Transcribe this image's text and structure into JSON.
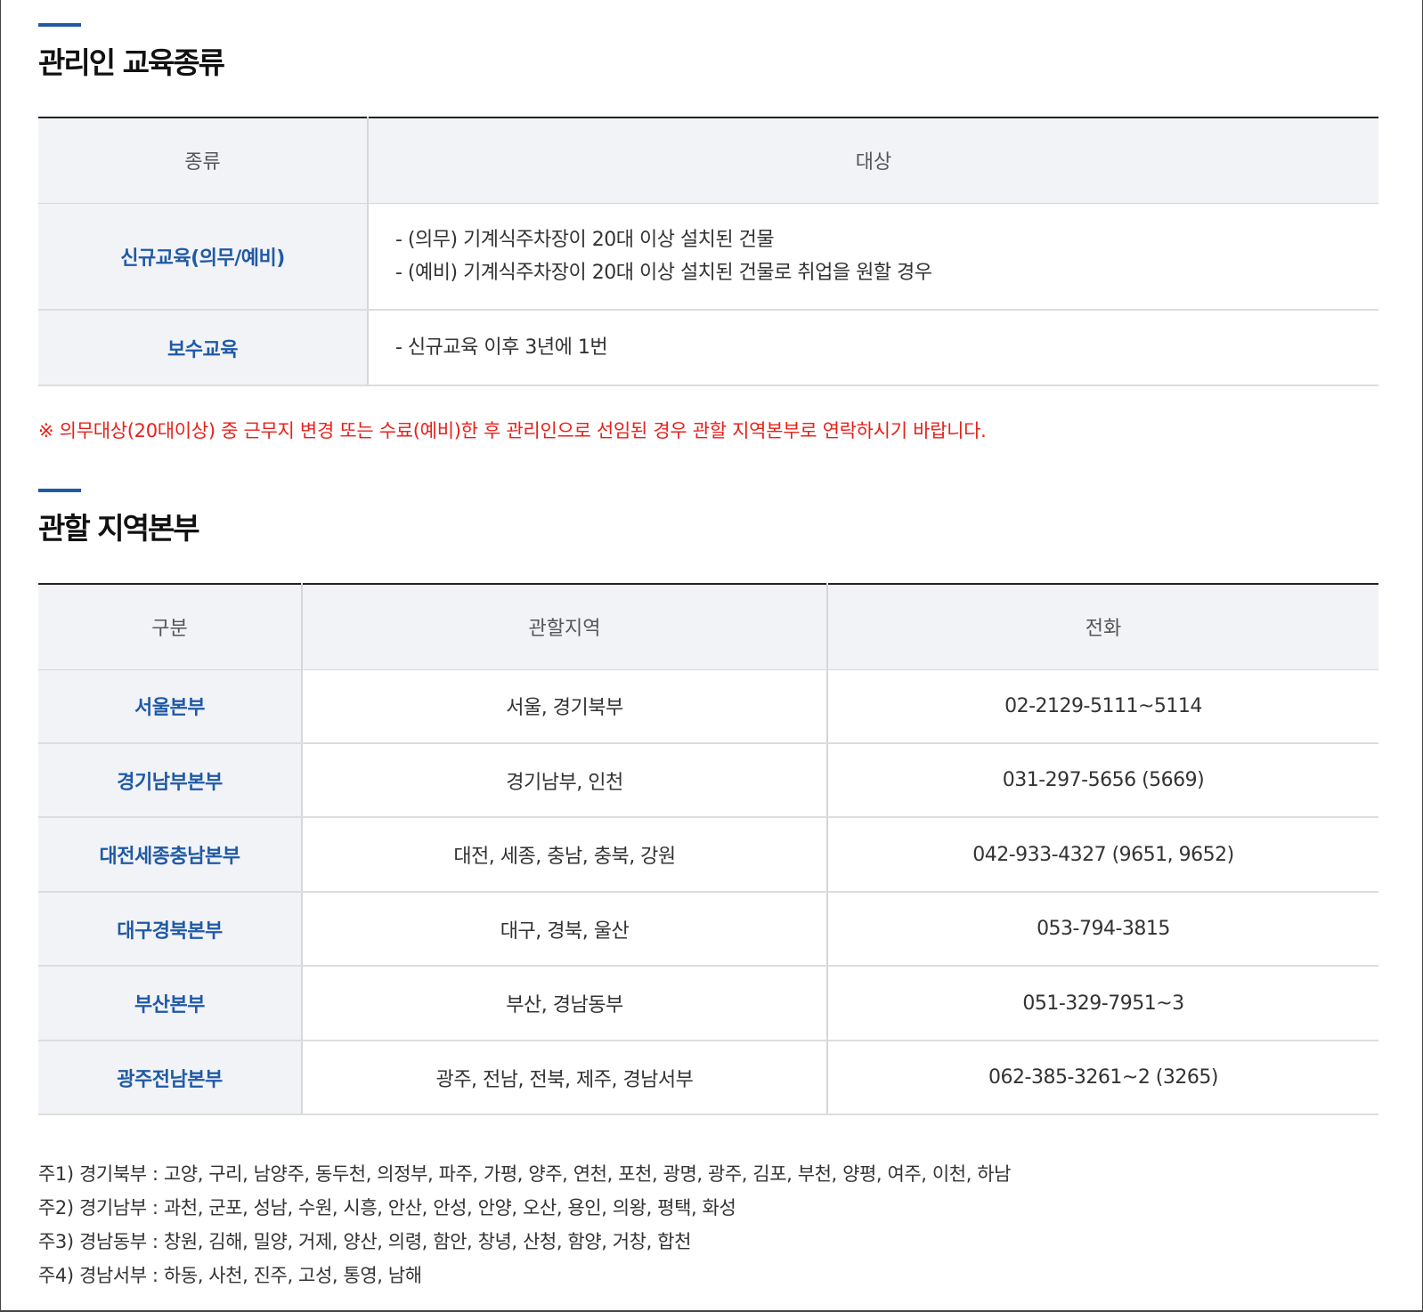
{
  "section1": {
    "title": "관리인 교육종류",
    "headers": [
      "종류",
      "대상"
    ],
    "rows": [
      {
        "type": "신규교육(의무/예비)",
        "lines": [
          "- (의무) 기계식주차장이 20대 이상 설치된 건물",
          "- (예비) 기계식주차장이 20대 이상 설치된 건물로 취업을 원할 경우"
        ]
      },
      {
        "type": "보수교육",
        "lines": [
          "- 신규교육 이후 3년에 1번"
        ]
      }
    ],
    "notice": "※ 의무대상(20대이상) 중 근무지 변경 또는 수료(예비)한 후 관리인으로 선임된 경우 관할 지역본부로 연락하시기 바랍니다."
  },
  "section2": {
    "title": "관할 지역본부",
    "headers": [
      "구분",
      "관할지역",
      "전화"
    ],
    "rows": [
      {
        "name": "서울본부",
        "region": "서울, 경기북부",
        "phone": "02-2129-5111~5114"
      },
      {
        "name": "경기남부본부",
        "region": "경기남부, 인천",
        "phone": "031-297-5656 (5669)"
      },
      {
        "name": "대전세종충남본부",
        "region": "대전, 세종, 충남, 충북, 강원",
        "phone": "042-933-4327 (9651, 9652)"
      },
      {
        "name": "대구경북본부",
        "region": "대구, 경북, 울산",
        "phone": "053-794-3815"
      },
      {
        "name": "부산본부",
        "region": "부산, 경남동부",
        "phone": "051-329-7951~3"
      },
      {
        "name": "광주전남본부",
        "region": "광주, 전남, 전북, 제주, 경남서부",
        "phone": "062-385-3261~2 (3265)"
      }
    ],
    "footnotes": [
      "주1) 경기북부 : 고양, 구리, 남양주, 동두천, 의정부, 파주, 가평, 양주, 연천, 포천, 광명, 광주, 김포, 부천, 양평, 여주, 이천, 하남",
      "주2) 경기남부 : 과천, 군포, 성남, 수원, 시흥, 안산, 안성, 안양, 오산, 용인, 의왕, 평택, 화성",
      "주3) 경남동부 : 창원, 김해, 밀양, 거제, 양산, 의령, 함안, 창녕, 산청, 함양, 거창, 합천",
      "주4) 경남서부 : 하동, 사천, 진주, 고성, 통영, 남해"
    ]
  },
  "colors": {
    "accent_blue": "#1f5aa6",
    "notice_red": "#e8211b",
    "header_bg": "#f2f3f6"
  }
}
